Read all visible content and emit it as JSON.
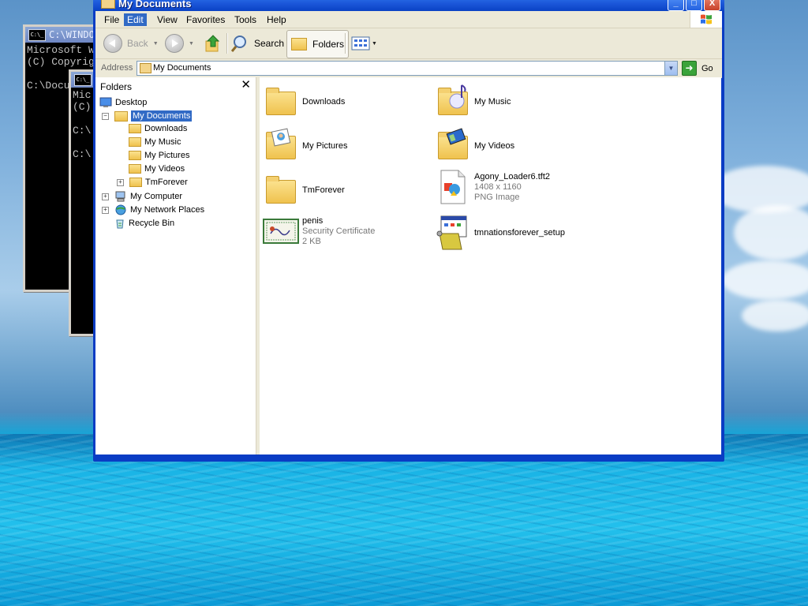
{
  "console_windows": [
    {
      "title": "C:\\WINDOWS",
      "lines": [
        "Microsoft W",
        "(C) Copyrig",
        "",
        "C:\\Docu"
      ]
    },
    {
      "title": "",
      "lines": [
        "Mic",
        "(C)",
        "",
        "C:\\",
        "",
        "C:\\"
      ]
    }
  ],
  "window": {
    "title": "My Documents",
    "buttons": {
      "minimize": "_",
      "maximize": "□",
      "close": "X"
    }
  },
  "menu": [
    "File",
    "Edit",
    "View",
    "Favorites",
    "Tools",
    "Help"
  ],
  "menu_active": "Edit",
  "toolbar": {
    "back_label": "Back",
    "search_label": "Search",
    "folders_label": "Folders"
  },
  "address": {
    "label": "Address",
    "value": "My Documents",
    "go_label": "Go"
  },
  "folders_pane": {
    "title": "Folders",
    "close": "✕",
    "tree": [
      {
        "label": "Desktop"
      },
      {
        "label": "My Documents",
        "expanded": true,
        "selected": true
      },
      {
        "label": "Downloads"
      },
      {
        "label": "My Music"
      },
      {
        "label": "My Pictures"
      },
      {
        "label": "My Videos"
      },
      {
        "label": "TmForever",
        "expandable": true
      },
      {
        "label": "My Computer",
        "expandable": true
      },
      {
        "label": "My Network Places",
        "expandable": true
      },
      {
        "label": "Recycle Bin"
      }
    ]
  },
  "items": [
    {
      "name": "Downloads"
    },
    {
      "name": "My Music"
    },
    {
      "name": "My Pictures"
    },
    {
      "name": "My Videos"
    },
    {
      "name": "TmForever"
    },
    {
      "name": "Agony_Loader6.tft2",
      "line2": "1408 x 1160",
      "line3": "PNG Image"
    },
    {
      "name": "penis",
      "line2": "Security Certificate",
      "line3": "2 KB"
    },
    {
      "name": "tmnationsforever_setup"
    }
  ]
}
